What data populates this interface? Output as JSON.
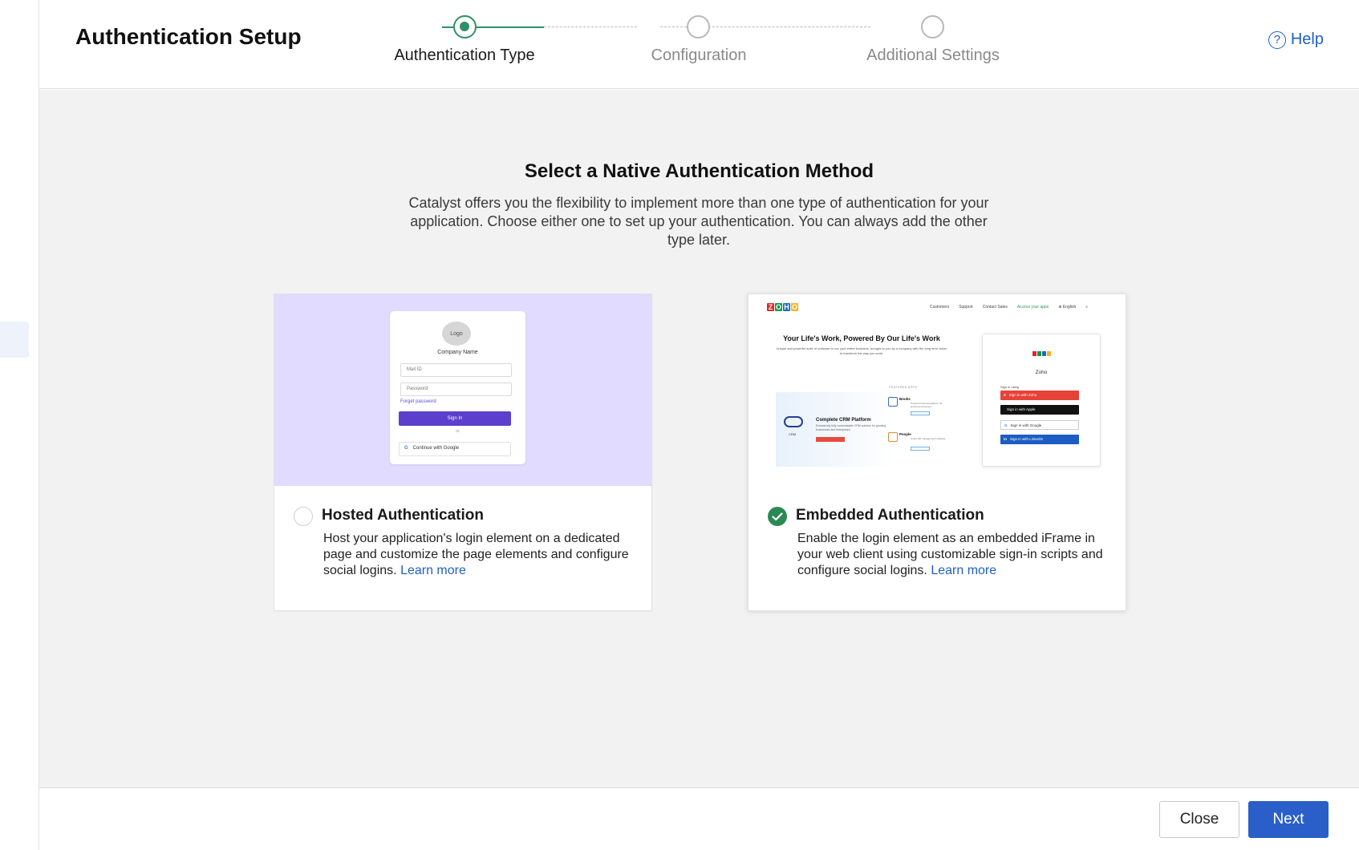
{
  "header": {
    "title": "Authentication Setup",
    "help_label": "Help",
    "help_glyph": "?"
  },
  "stepper": {
    "steps": [
      {
        "label": "Authentication Type",
        "state": "active"
      },
      {
        "label": "Configuration",
        "state": "pending"
      },
      {
        "label": "Additional Settings",
        "state": "pending"
      }
    ]
  },
  "main": {
    "title": "Select a Native Authentication Method",
    "description": "Catalyst offers you the flexibility to implement more than one type of authentication for your application. Choose either one to set up your authentication. You can always add the other type later."
  },
  "cards": {
    "hosted": {
      "title": "Hosted Authentication",
      "description": "Host your application's login element on a dedicated page and customize the page elements and configure social logins.",
      "learn_more": "Learn more",
      "selected": false,
      "preview": {
        "logo": "Logo",
        "company": "Company Name",
        "mail_placeholder": "Mail ID",
        "password_placeholder": "Password",
        "forgot": "Forget password",
        "signin": "Sign In",
        "or": "or",
        "google": "Continue with Google",
        "google_glyph": "G"
      }
    },
    "embedded": {
      "title": "Embedded Authentication",
      "description": "Enable the login element as an embedded iFrame in your web client using customizable sign-in scripts and configure social logins.",
      "learn_more": "Learn more",
      "selected": true,
      "preview": {
        "logo_letters": [
          "Z",
          "O",
          "H",
          "O"
        ],
        "nav": [
          "Customers",
          "Support",
          "Contact Sales",
          "Access your apps",
          "⊕ English",
          "⌕"
        ],
        "hero": "Your Life's Work, Powered By Our Life's Work",
        "hero_sub": "Unique and powerful suite of software to run your entire business, brought to you by a company with the long term vision to transform the way you work.",
        "featured": "FEATURED APPS",
        "crm_label": "CRM",
        "crm_title": "Complete CRM Platform",
        "crm_text": "Excessively fully customizable CRM solution for growing businesses and enterprises.",
        "app_books": "Books",
        "app_books_text": "Powerful financial platform for growing businesses",
        "app_people": "People",
        "app_people_text": "Smart HR management software",
        "panel_title": "Zoho",
        "panel_using": "Sign in using",
        "signin_zoho": "Sign in with Zoho",
        "signin_apple": "Sign in with Apple",
        "signin_google": "Sign in with Google",
        "signin_linkedin": "Sign in with LinkedIn",
        "zoho_glyph": "Z",
        "apple_glyph": "",
        "google_glyph": "G",
        "linkedin_glyph": "in"
      }
    }
  },
  "footer": {
    "close_label": "Close",
    "next_label": "Next"
  },
  "colors": {
    "accent_green": "#2f9068",
    "check_green": "#2a8a54",
    "primary_blue": "#2a5fc9",
    "link_blue": "#1f5fc7",
    "hosted_preview_bg": "#e0dbff"
  }
}
